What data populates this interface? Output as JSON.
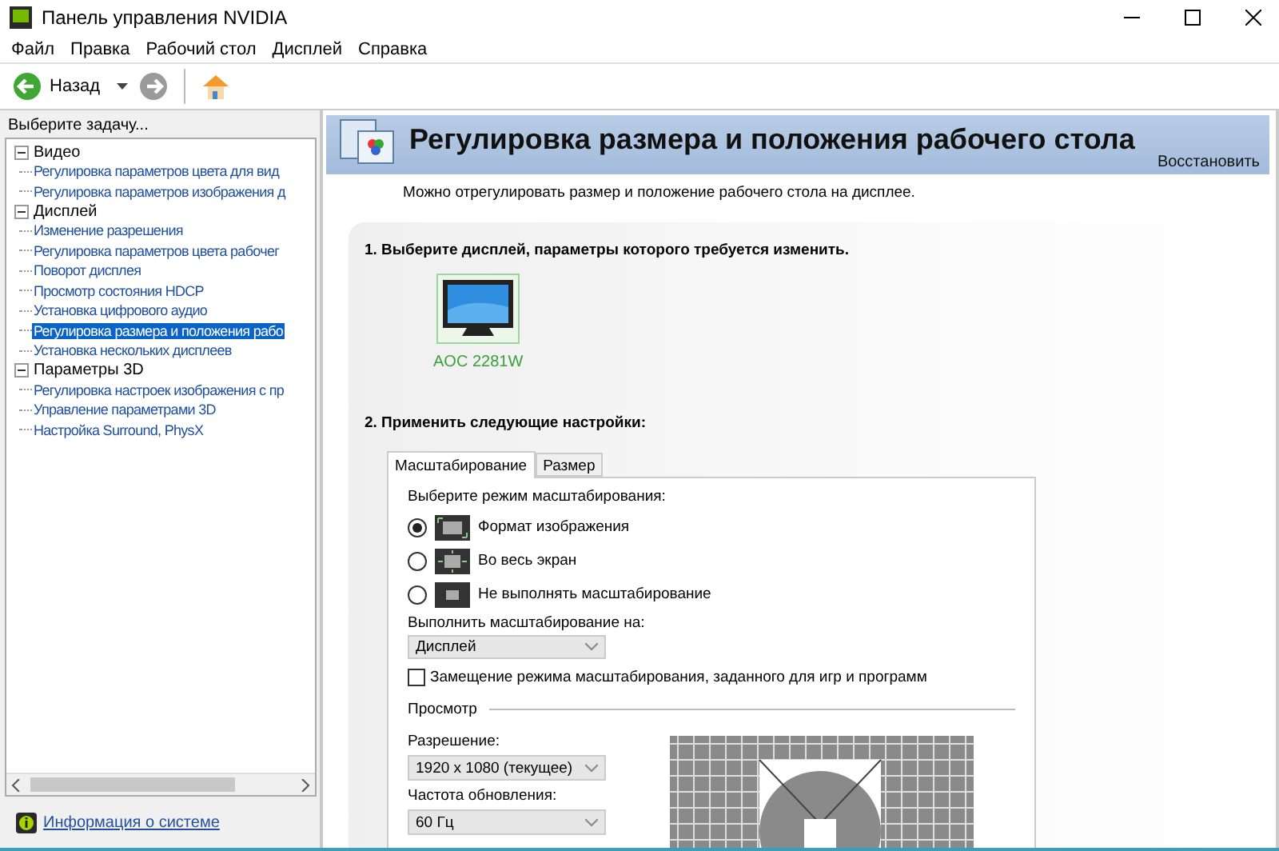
{
  "window": {
    "title": "Панель управления NVIDIA"
  },
  "menu": [
    "Файл",
    "Правка",
    "Рабочий стол",
    "Дисплей",
    "Справка"
  ],
  "toolbar": {
    "back_label": "Назад"
  },
  "task_panel": {
    "heading": "Выберите задачу...",
    "tree": [
      {
        "label": "Видео",
        "expanded": true,
        "selected": false,
        "children": [
          {
            "label": "Регулировка параметров цвета для вид",
            "selected": false
          },
          {
            "label": "Регулировка параметров изображения д",
            "selected": false
          }
        ]
      },
      {
        "label": "Дисплей",
        "expanded": true,
        "selected": false,
        "children": [
          {
            "label": "Изменение разрешения",
            "selected": false
          },
          {
            "label": "Регулировка параметров цвета рабочег",
            "selected": false
          },
          {
            "label": "Поворот дисплея",
            "selected": false
          },
          {
            "label": "Просмотр состояния HDCP",
            "selected": false
          },
          {
            "label": "Установка цифрового аудио",
            "selected": false
          },
          {
            "label": "Регулировка размера и положения рабо",
            "selected": true
          },
          {
            "label": "Установка нескольких дисплеев",
            "selected": false
          }
        ]
      },
      {
        "label": "Параметры 3D",
        "expanded": true,
        "selected": false,
        "children": [
          {
            "label": "Регулировка настроек изображения с пр",
            "selected": false
          },
          {
            "label": "Управление параметрами 3D",
            "selected": false
          },
          {
            "label": "Настройка Surround, PhysX",
            "selected": false
          }
        ]
      }
    ],
    "system_info_link": "Информация о системе"
  },
  "page": {
    "title": "Регулировка размера и положения рабочего стола",
    "restore_link": "Восстановить",
    "description": "Можно отрегулировать размер и положение рабочего стола на дисплее.",
    "step1": {
      "heading": "1. Выберите дисплей, параметры которого требуется изменить.",
      "displays": [
        {
          "name": "AOC 2281W",
          "selected": true
        }
      ]
    },
    "step2": {
      "heading": "2. Применить следующие настройки:",
      "tabs": [
        {
          "label": "Масштабирование",
          "selected": true
        },
        {
          "label": "Размер",
          "selected": false
        }
      ],
      "scaling_mode_label": "Выберите режим масштабирования:",
      "scaling_modes": [
        {
          "kind": "aspect",
          "label": "Формат изображения",
          "selected": true
        },
        {
          "kind": "fullscreen",
          "label": "Во весь экран",
          "selected": false
        },
        {
          "kind": "none",
          "label": "Не выполнять масштабирование",
          "selected": false
        }
      ],
      "perform_on_label": "Выполнить масштабирование на:",
      "perform_on_value": "Дисплей",
      "override_checkbox": {
        "label": "Замещение режима масштабирования, заданного для игр и программ",
        "checked": false
      },
      "preview_label": "Просмотр",
      "resolution_label": "Разрешение:",
      "resolution_value": "1920 x 1080 (текущее)",
      "refresh_label": "Частота обновления:",
      "refresh_value": "60 Гц"
    }
  }
}
